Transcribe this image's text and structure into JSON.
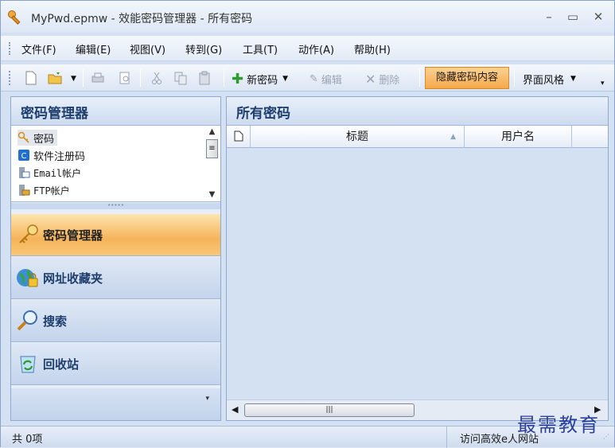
{
  "window": {
    "title": "MyPwd.epmw - 效能密码管理器 - 所有密码",
    "icon": "key-icon"
  },
  "menu": [
    "文件(F)",
    "编辑(E)",
    "视图(V)",
    "转到(G)",
    "工具(T)",
    "动作(A)",
    "帮助(H)"
  ],
  "toolbar": {
    "new_password": "新密码",
    "edit": "编辑",
    "delete": "删除",
    "hide_content": "隐藏密码内容",
    "ui_style": "界面风格"
  },
  "left_panel": {
    "title": "密码管理器",
    "categories": [
      {
        "label": "密码",
        "icon": "key-icon"
      },
      {
        "label": "软件注册码",
        "icon": "software-icon"
      },
      {
        "label": "Email帐户",
        "icon": "email-icon"
      },
      {
        "label": "FTP帐户",
        "icon": "ftp-icon"
      }
    ],
    "nav": [
      {
        "label": "密码管理器",
        "icon": "key-icon",
        "active": true
      },
      {
        "label": "网址收藏夹",
        "icon": "globe-lock-icon",
        "active": false
      },
      {
        "label": "搜索",
        "icon": "magnifier-icon",
        "active": false
      },
      {
        "label": "回收站",
        "icon": "recycle-bin-icon",
        "active": false
      }
    ]
  },
  "right_panel": {
    "title": "所有密码",
    "columns": [
      "标题",
      "用户名"
    ]
  },
  "status": {
    "count": "共 0项",
    "link": "访问高效e人网站"
  },
  "watermark": "最需教育",
  "colors": {
    "accent": "#f6b45a",
    "header_text": "#1e3e6e"
  }
}
